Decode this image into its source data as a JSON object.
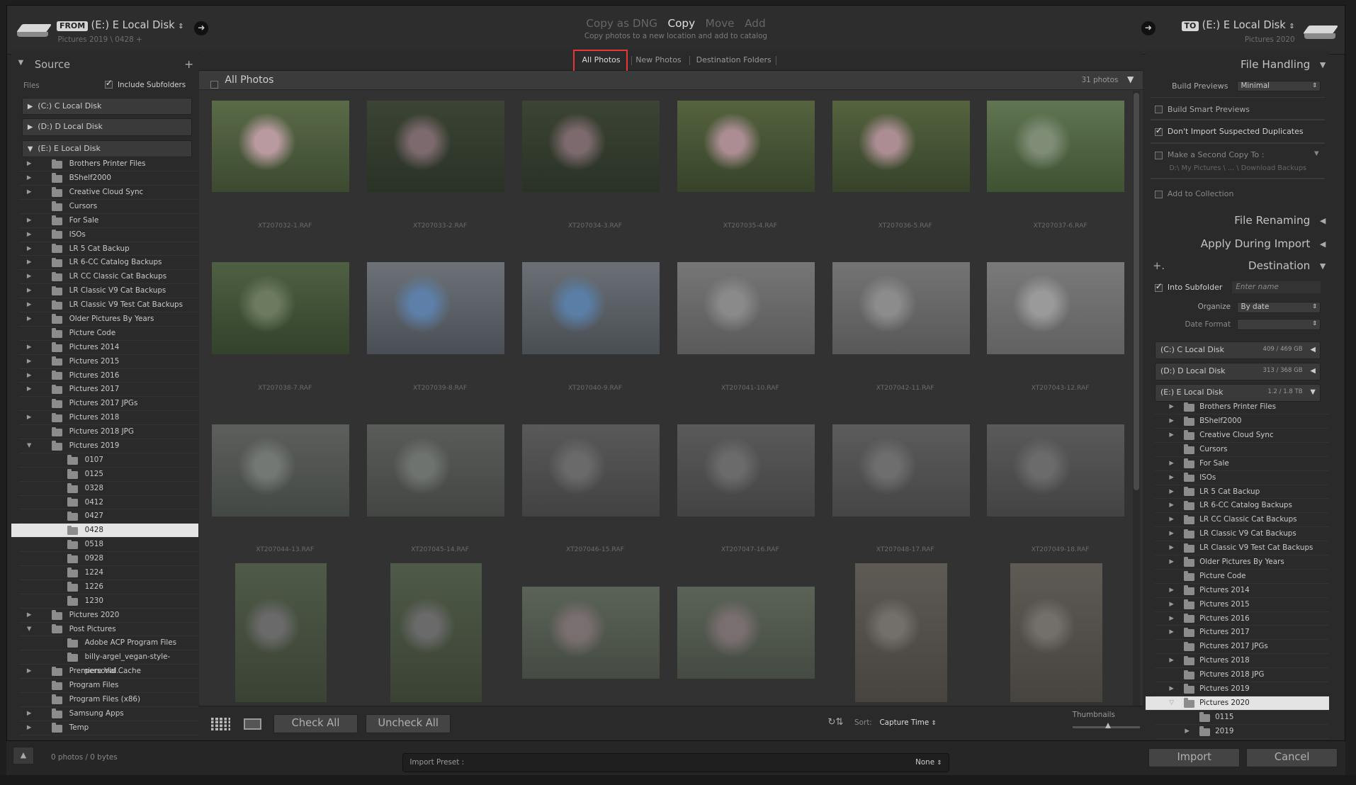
{
  "from": {
    "tag": "FROM",
    "disk": "(E:) E Local Disk",
    "path": "Pictures 2019 \\ 0428 +"
  },
  "modes": {
    "dng": "Copy as DNG",
    "copy": "Copy",
    "move": "Move",
    "add": "Add",
    "desc": "Copy photos to a new location and add to catalog"
  },
  "to": {
    "tag": "TO",
    "disk": "(E:) E Local Disk",
    "path": "Pictures 2020"
  },
  "source": {
    "title": "Source",
    "files": "Files",
    "include": "Include Subfolders",
    "disks": [
      "(C:) C Local Disk",
      "(D:) D Local Disk",
      "(E:) E Local Disk"
    ],
    "folders": [
      "Brothers Printer Files",
      "BShelf2000",
      "Creative Cloud Sync",
      "Cursors",
      "For Sale",
      "ISOs",
      "LR 5 Cat Backup",
      "LR 6-CC Catalog Backups",
      "LR CC Classic Cat Backups",
      "LR Classic V9 Cat Backups",
      "LR Classic V9 Test Cat Backups",
      "Older Pictures By Years",
      "Picture Code",
      "Pictures 2014",
      "Pictures 2015",
      "Pictures 2016",
      "Pictures 2017",
      "Pictures 2017 JPGs",
      "Pictures 2018",
      "Pictures 2018 JPG",
      "Pictures 2019",
      "0107",
      "0125",
      "0328",
      "0412",
      "0427",
      "0428",
      "0518",
      "0928",
      "1224",
      "1226",
      "1230",
      "Pictures 2020",
      "Post Pictures",
      "Adobe ACP Program Files",
      "billy-argel_vegan-style-personal...",
      "Premiere Vid Cache",
      "Program Files",
      "Program Files (x86)",
      "Samsung Apps",
      "Temp"
    ]
  },
  "tabs": {
    "all": "All Photos",
    "new": "New Photos",
    "dest": "Destination Folders"
  },
  "grid": {
    "title": "All Photos",
    "count": "31 photos",
    "files": [
      "XT207032-1.RAF",
      "XT207033-2.RAF",
      "XT207034-3.RAF",
      "XT207035-4.RAF",
      "XT207036-5.RAF",
      "XT207037-6.RAF",
      "XT207038-7.RAF",
      "XT207039-8.RAF",
      "XT207040-9.RAF",
      "XT207041-10.RAF",
      "XT207042-11.RAF",
      "XT207043-12.RAF",
      "XT207044-13.RAF",
      "XT207045-14.RAF",
      "XT207046-15.RAF",
      "XT207047-16.RAF",
      "XT207048-17.RAF",
      "XT207049-18.RAF"
    ]
  },
  "toolbar": {
    "check": "Check All",
    "uncheck": "Uncheck All",
    "sort_label": "Sort:",
    "sort": "Capture Time",
    "thumbs": "Thumbnails"
  },
  "right": {
    "file_handling": "File Handling",
    "build_previews": "Build Previews",
    "previews_val": "Minimal",
    "smart": "Build Smart Previews",
    "dupes": "Don't Import Suspected Duplicates",
    "second": "Make a Second Copy To :",
    "second_path": "D:\\ My Pictures \\ ... \\ Download Backups",
    "collection": "Add to Collection",
    "renaming": "File Renaming",
    "apply": "Apply During Import",
    "destination": "Destination",
    "into_sub": "Into Subfolder",
    "enter_name": "Enter name",
    "organize": "Organize",
    "organize_val": "By date",
    "date_format": "Date Format",
    "disks": [
      {
        "name": "(C:) C Local Disk",
        "size": "409 / 469 GB"
      },
      {
        "name": "(D:) D Local Disk",
        "size": "313 / 368 GB"
      },
      {
        "name": "(E:) E Local Disk",
        "size": "1.2 / 1.8 TB"
      }
    ],
    "folders": [
      "Brothers Printer Files",
      "BShelf2000",
      "Creative Cloud Sync",
      "Cursors",
      "For Sale",
      "ISOs",
      "LR 5 Cat Backup",
      "LR 6-CC Catalog Backups",
      "LR CC Classic Cat Backups",
      "LR Classic V9 Cat Backups",
      "LR Classic V9 Test Cat Backups",
      "Older Pictures By Years",
      "Picture Code",
      "Pictures 2014",
      "Pictures 2015",
      "Pictures 2016",
      "Pictures 2017",
      "Pictures 2017 JPGs",
      "Pictures 2018",
      "Pictures 2018 JPG",
      "Pictures 2019",
      "Pictures 2020",
      "0115",
      "2019"
    ]
  },
  "status": {
    "bytes": "0 photos / 0 bytes",
    "preset_label": "Import Preset :",
    "preset_val": "None",
    "import": "Import",
    "cancel": "Cancel"
  }
}
